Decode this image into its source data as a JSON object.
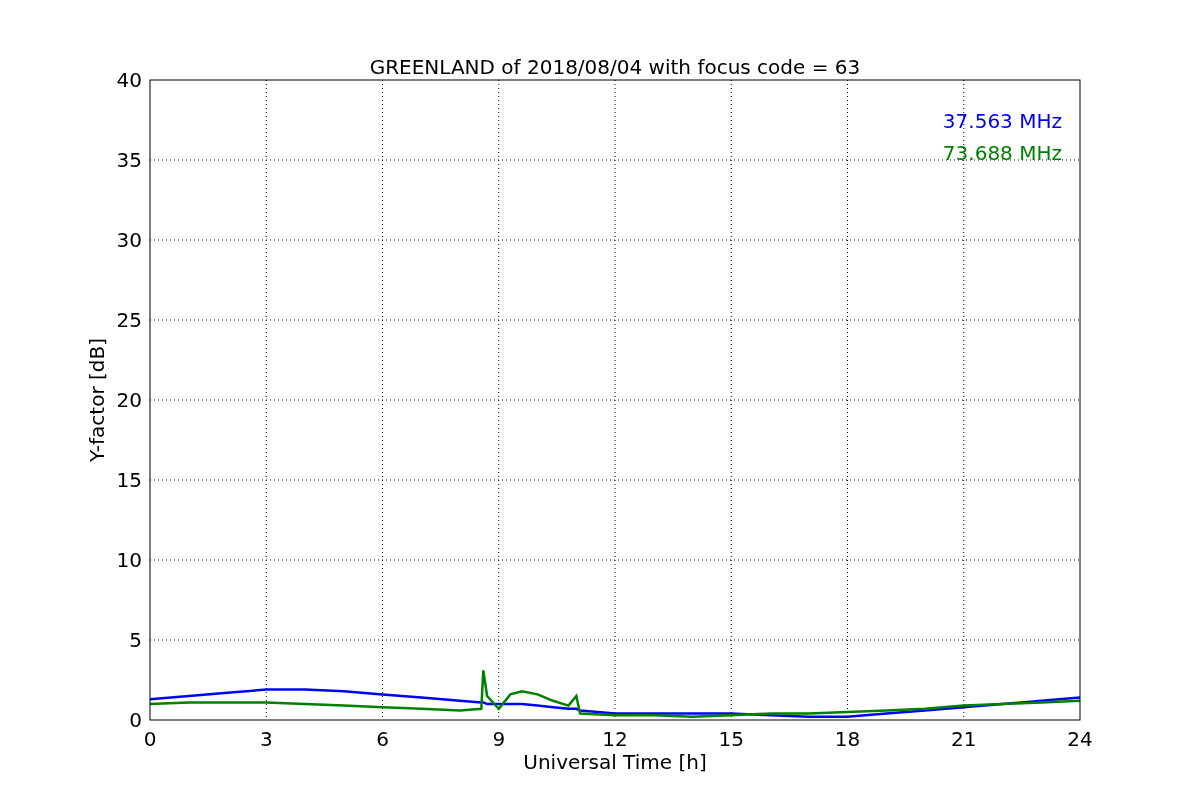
{
  "chart_data": {
    "type": "line",
    "title": "GREENLAND of 2018/08/04 with focus code = 63",
    "xlabel": "Universal Time [h]",
    "ylabel": "Y-factor [dB]",
    "x": [
      0,
      1,
      2,
      3,
      4,
      5,
      6,
      7,
      8,
      8.55,
      8.6,
      8.7,
      9,
      9.3,
      9.6,
      10,
      10.4,
      10.8,
      11,
      11.1,
      12,
      13,
      14,
      15,
      16,
      17,
      18,
      19,
      20,
      21,
      22,
      23,
      24
    ],
    "series": [
      {
        "name": "37.563 MHz",
        "color": "#0000ff",
        "values": [
          1.3,
          1.5,
          1.7,
          1.9,
          1.9,
          1.8,
          1.6,
          1.4,
          1.2,
          1.1,
          1.1,
          1.0,
          1.0,
          1.0,
          1.0,
          0.9,
          0.8,
          0.7,
          0.7,
          0.6,
          0.4,
          0.4,
          0.4,
          0.4,
          0.3,
          0.2,
          0.2,
          0.4,
          0.6,
          0.8,
          1.0,
          1.2,
          1.4
        ]
      },
      {
        "name": "73.688 MHz",
        "color": "#008000",
        "values": [
          1.0,
          1.1,
          1.1,
          1.1,
          1.0,
          0.9,
          0.8,
          0.7,
          0.6,
          0.7,
          3.1,
          1.5,
          0.7,
          1.6,
          1.8,
          1.6,
          1.2,
          0.9,
          1.5,
          0.4,
          0.3,
          0.3,
          0.2,
          0.3,
          0.4,
          0.4,
          0.5,
          0.6,
          0.7,
          0.9,
          1.0,
          1.1,
          1.2
        ]
      }
    ],
    "xlim": [
      0,
      24
    ],
    "ylim": [
      0,
      40
    ],
    "xticks": [
      0,
      3,
      6,
      9,
      12,
      15,
      18,
      21,
      24
    ],
    "yticks": [
      0,
      5,
      10,
      15,
      20,
      25,
      30,
      35,
      40
    ],
    "grid": true
  }
}
